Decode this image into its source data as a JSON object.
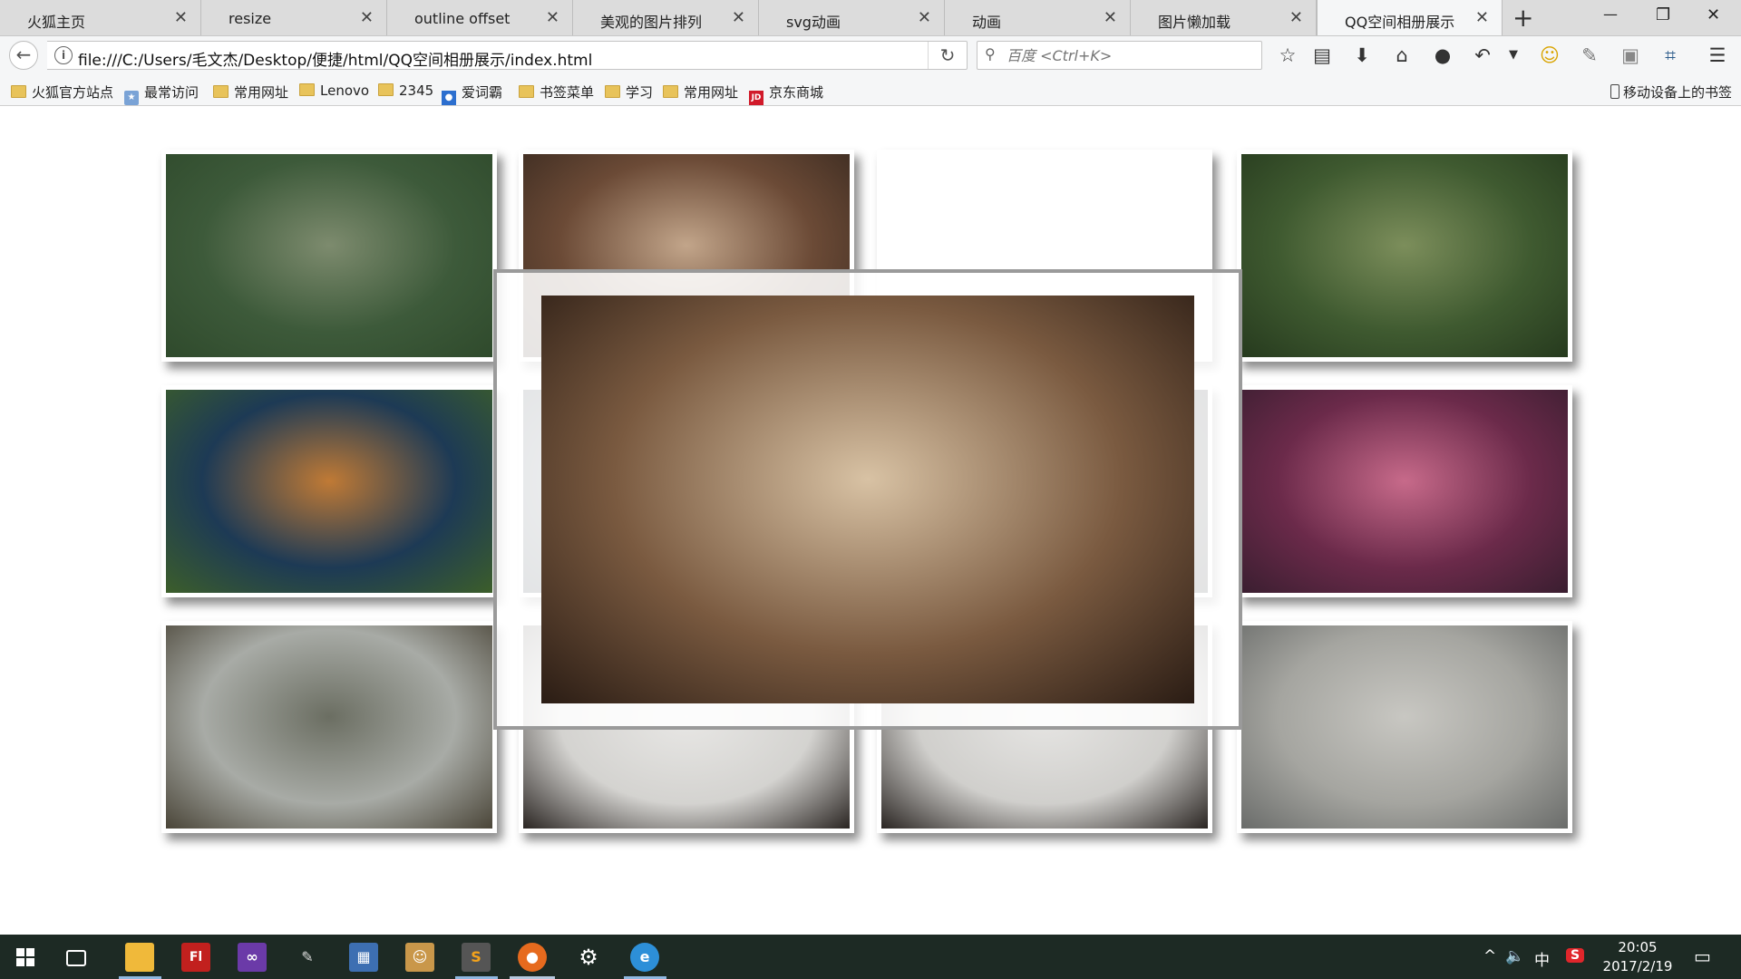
{
  "tabs": [
    {
      "label": "火狐主页",
      "active": false
    },
    {
      "label": "resize",
      "active": false
    },
    {
      "label": "outline offset",
      "active": false
    },
    {
      "label": "美观的图片排列",
      "active": false
    },
    {
      "label": "svg动画",
      "active": false
    },
    {
      "label": "动画",
      "active": false
    },
    {
      "label": "图片懒加载",
      "active": false
    },
    {
      "label": "QQ空间相册展示",
      "active": true
    }
  ],
  "tab_close_glyph": "✕",
  "new_tab_glyph": "+",
  "window_controls": {
    "minimize": "—",
    "restore": "❐",
    "close": "✕"
  },
  "address_bar": {
    "url": "file:///C:/Users/毛文杰/Desktop/便捷/html/QQ空间相册展示/index.html",
    "info_glyph": "i",
    "back_glyph": "←",
    "reload_glyph": "↻"
  },
  "search": {
    "placeholder": "百度 <Ctrl+K>",
    "icon": "search-icon"
  },
  "toolbar_icons": [
    "bookmark-star-icon",
    "reading-list-icon",
    "download-icon",
    "home-icon",
    "sync-account-icon",
    "undo-icon",
    "dropdown-icon",
    "emoji-icon",
    "extension-icon",
    "screenshot-icon",
    "crop-icon",
    "menu-icon"
  ],
  "bookmarks": [
    {
      "label": "火狐官方站点",
      "icon": "folder"
    },
    {
      "label": "最常访问",
      "icon": "special"
    },
    {
      "label": "常用网址",
      "icon": "folder"
    },
    {
      "label": "Lenovo",
      "icon": "folder"
    },
    {
      "label": "2345",
      "icon": "folder"
    },
    {
      "label": "爱词霸",
      "icon": "special"
    },
    {
      "label": "书签菜单",
      "icon": "folder"
    },
    {
      "label": "学习",
      "icon": "folder"
    },
    {
      "label": "常用网址",
      "icon": "folder"
    },
    {
      "label": "京东商城",
      "icon": "jd"
    }
  ],
  "mobile_bookmarks": "移动设备上的书签",
  "gallery": {
    "photos": [
      {
        "name": "photo-girl-forest",
        "colors": [
          "#3d5a3a",
          "#7d8b6e",
          "#2f4a2c"
        ]
      },
      {
        "name": "photo-girl-bookstore",
        "colors": [
          "#6b4a36",
          "#c2a58a",
          "#3a2a20"
        ]
      },
      {
        "name": "photo-blank",
        "colors": [
          "#ffffff",
          "#ffffff",
          "#ffffff"
        ]
      },
      {
        "name": "photo-girl-pine",
        "colors": [
          "#3f5a30",
          "#7c8e5b",
          "#263a1e"
        ]
      },
      {
        "name": "photo-mountain-sunset",
        "colors": [
          "#1d3a55",
          "#c07a35",
          "#3c5e2a"
        ]
      },
      {
        "name": "photo-hidden-2",
        "colors": [
          "#5a6670",
          "#a8aaa2",
          "#1a2530"
        ]
      },
      {
        "name": "photo-hidden-3",
        "colors": [
          "#3a3d40",
          "#8a8a88",
          "#1d1f22"
        ]
      },
      {
        "name": "photo-cherry-temple",
        "colors": [
          "#6b2a4a",
          "#c76a8a",
          "#3a1e30"
        ]
      },
      {
        "name": "photo-girl-railway",
        "colors": [
          "#a8aba6",
          "#6b6e62",
          "#4a4538"
        ]
      },
      {
        "name": "photo-girl-white-1",
        "colors": [
          "#d4d3d0",
          "#e8e7e5",
          "#2a2522"
        ]
      },
      {
        "name": "photo-girl-white-2",
        "colors": [
          "#d0cfcc",
          "#e6e5e3",
          "#2a2522"
        ]
      },
      {
        "name": "photo-girl-scarf",
        "colors": [
          "#a5a5a0",
          "#c8c7c2",
          "#6a6c6a"
        ]
      }
    ],
    "preview": {
      "name": "photo-girl-bookstore-enlarged",
      "colors": [
        "#7a5a40",
        "#d8c2a4",
        "#2a1c14"
      ]
    }
  },
  "taskbar": {
    "apps": [
      "start-button",
      "task-view-icon",
      "file-explorer-icon",
      "flash-icon",
      "visual-studio-icon",
      "paint-tool-icon",
      "app-icon",
      "photo-app-icon",
      "sublime-icon",
      "firefox-icon",
      "settings-icon",
      "ie-icon"
    ],
    "tray": {
      "chevron": "^",
      "volume": "🔈",
      "ime": "中",
      "sogou": "S"
    },
    "time": "20:05",
    "date": "2017/2/19"
  }
}
